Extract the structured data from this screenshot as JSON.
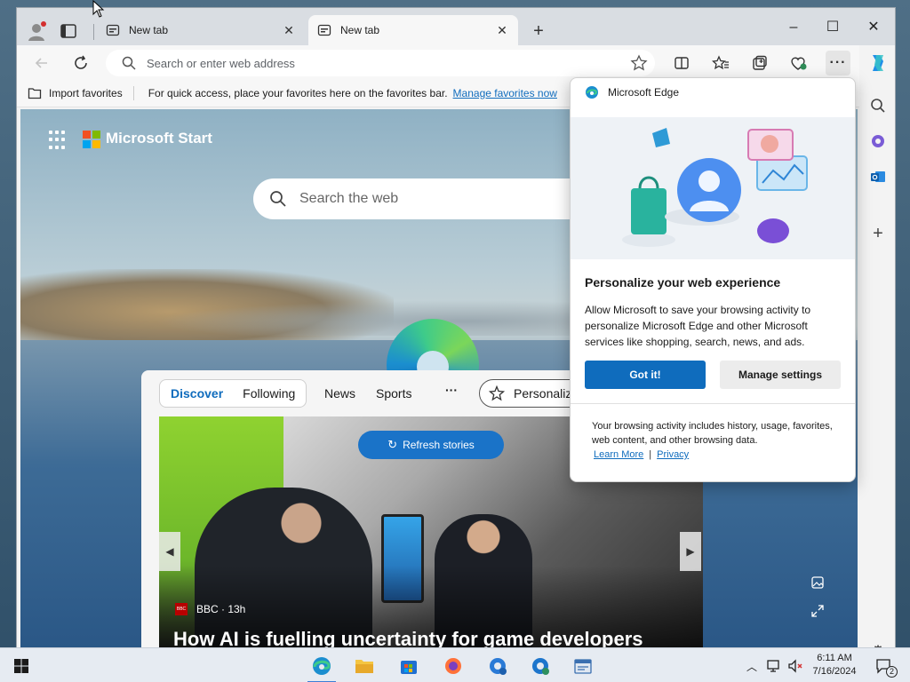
{
  "tabs": [
    {
      "title": "New tab"
    },
    {
      "title": "New tab"
    }
  ],
  "address": {
    "placeholder": "Search or enter web address"
  },
  "favorites_bar": {
    "import_label": "Import favorites",
    "message": "For quick access, place your favorites here on the favorites bar.",
    "manage_link": "Manage favorites now"
  },
  "ntp": {
    "brand": "Microsoft Start",
    "search_placeholder": "Search the web",
    "feed_tabs": [
      "Discover",
      "Following"
    ],
    "feed_links": [
      "News",
      "Sports"
    ],
    "more": "···",
    "personalize": "Personalize",
    "refresh": "Refresh stories",
    "story": {
      "source": "BBC · 13h",
      "headline": "How AI is fuelling uncertainty for game developers"
    }
  },
  "popup": {
    "app_name": "Microsoft Edge",
    "title": "Personalize your web experience",
    "body": "Allow Microsoft to save your browsing activity to personalize Microsoft Edge and other Microsoft services like shopping, search, news, and ads.",
    "primary_button": "Got it!",
    "secondary_button": "Manage settings",
    "note": "Your browsing activity includes history, usage, favorites, web content, and other browsing data.",
    "learn_more": "Learn More",
    "link_sep": "|",
    "privacy": "Privacy"
  },
  "taskbar": {
    "time": "6:11 AM",
    "date": "7/16/2024",
    "notification_count": "2"
  },
  "colors": {
    "accent": "#0f6cbd",
    "refresh_button": "#1a73c8",
    "ms_red": "#f25022",
    "ms_green": "#7fba00",
    "ms_blue": "#00a4ef",
    "ms_yellow": "#ffb900"
  }
}
